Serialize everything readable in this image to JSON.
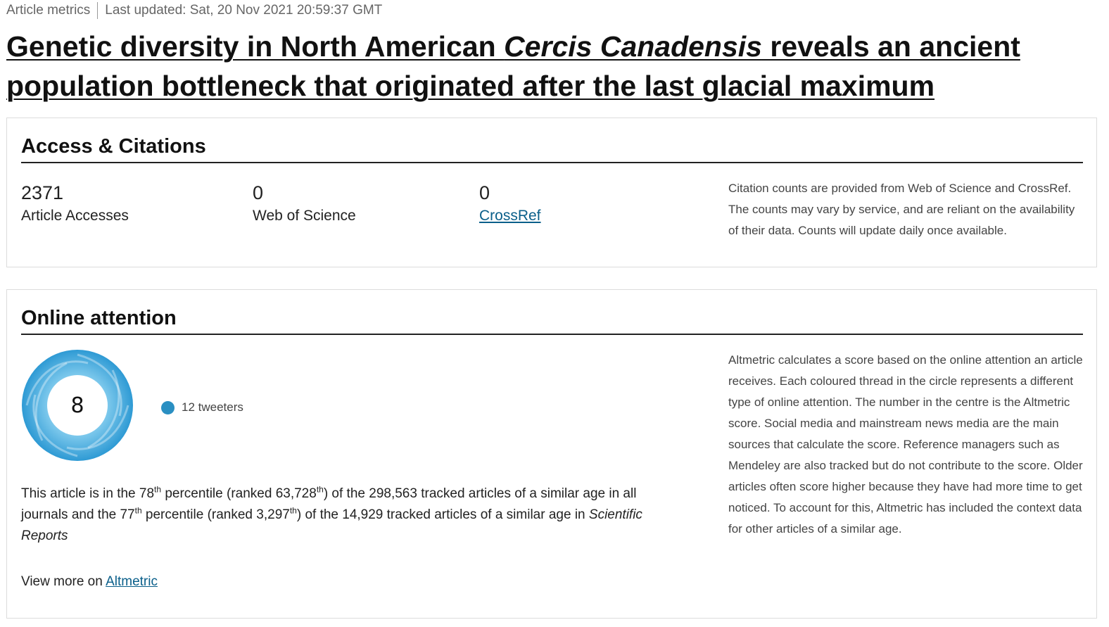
{
  "meta": {
    "label": "Article metrics",
    "updated": "Last updated: Sat, 20 Nov 2021 20:59:37 GMT"
  },
  "title": {
    "before": "Genetic diversity in North American ",
    "italic": "Cercis Canadensis",
    "after": " reveals an ancient population bottleneck that originated after the last glacial maximum"
  },
  "access": {
    "heading": "Access & Citations",
    "metrics": [
      {
        "value": "2371",
        "label": "Article Accesses"
      },
      {
        "value": "0",
        "label": "Web of Science"
      },
      {
        "value": "0",
        "label": "CrossRef"
      }
    ],
    "note": "Citation counts are provided from Web of Science and CrossRef. The counts may vary by service, and are reliant on the availability of their data. Counts will update daily once available."
  },
  "attention": {
    "heading": "Online attention",
    "score": "8",
    "donut_color": "#3fa9dc",
    "legend": {
      "label": "12 tweeters",
      "color": "#2a8fc2"
    },
    "percentile": {
      "p1": "This article is in the 78",
      "th": "th",
      "p2": " percentile (ranked 63,728",
      "p3": ") of the 298,563 tracked articles of a similar age in all journals and the 77",
      "p4": " percentile (ranked 3,297",
      "p5": ") of the 14,929 tracked articles of a similar age in ",
      "journal": "Scientific Reports"
    },
    "view_more": {
      "prefix": "View more on ",
      "link": "Altmetric"
    },
    "note": "Altmetric calculates a score based on the online attention an article receives. Each coloured thread in the circle represents a different type of online attention. The number in the centre is the Altmetric score. Social media and mainstream news media are the main sources that calculate the score. Reference managers such as Mendeley are also tracked but do not contribute to the score. Older articles often score higher because they have had more time to get noticed. To account for this, Altmetric has included the context data for other articles of a similar age."
  }
}
